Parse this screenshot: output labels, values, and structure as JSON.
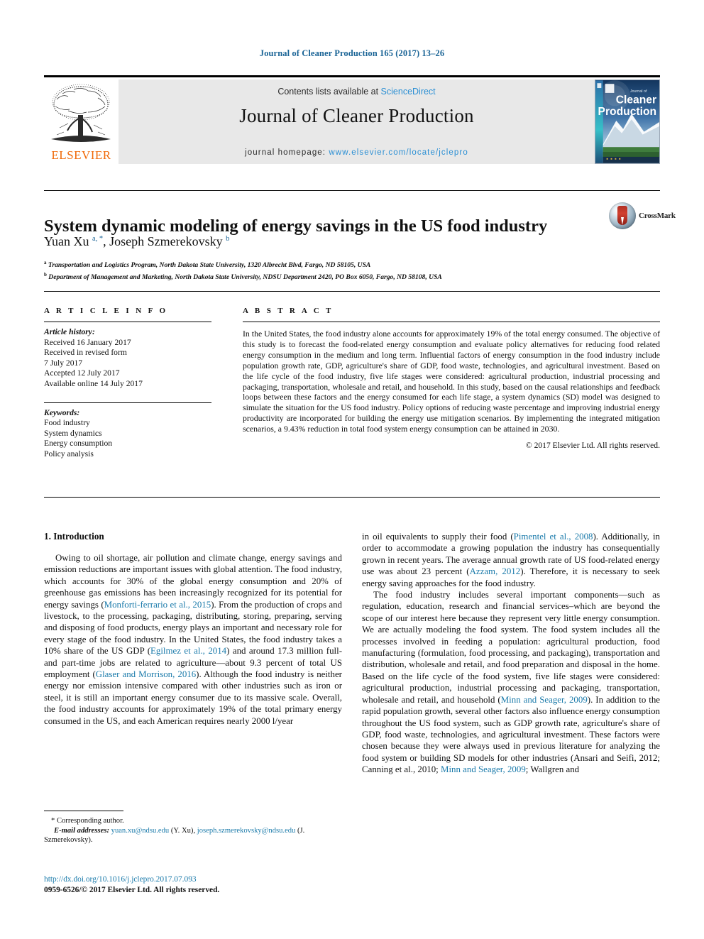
{
  "running_head": "Journal of Cleaner Production 165 (2017) 13–26",
  "masthead": {
    "publisher": "ELSEVIER",
    "contents_prefix": "Contents lists available at ",
    "contents_link": "ScienceDirect",
    "journal_title": "Journal of Cleaner Production",
    "homepage_prefix": "journal homepage: ",
    "homepage_url": "www.elsevier.com/locate/jclepro",
    "cover_title_small": "Journal of",
    "cover_title_line1": "Cleaner",
    "cover_title_line2": "Production"
  },
  "crossmark": {
    "label": "CrossMark"
  },
  "title": "System dynamic modeling of energy savings in the US food industry",
  "authors_html": "Yuan Xu <sup>a, *</sup>, Joseph Szmerekovsky <sup>b</sup>",
  "affiliations": [
    {
      "marker": "a",
      "text": "Transportation and Logistics Program, North Dakota State University, 1320 Albrecht Blvd, Fargo, ND 58105, USA"
    },
    {
      "marker": "b",
      "text": "Department of Management and Marketing, North Dakota State University, NDSU Department 2420, PO Box 6050, Fargo, ND 58108, USA"
    }
  ],
  "article_info": {
    "heading": "A R T I C L E  I N F O",
    "history_label": "Article history:",
    "history_lines": [
      "Received 16 January 2017",
      "Received in revised form",
      "7 July 2017",
      "Accepted 12 July 2017",
      "Available online 14 July 2017"
    ],
    "keywords_label": "Keywords:",
    "keywords": [
      "Food industry",
      "System dynamics",
      "Energy consumption",
      "Policy analysis"
    ]
  },
  "abstract": {
    "heading": "A B S T R A C T",
    "text": "In the United States, the food industry alone accounts for approximately 19% of the total energy consumed. The objective of this study is to forecast the food-related energy consumption and evaluate policy alternatives for reducing food related energy consumption in the medium and long term. Influential factors of energy consumption in the food industry include population growth rate, GDP, agriculture's share of GDP, food waste, technologies, and agricultural investment. Based on the life cycle of the food industry, five life stages were considered: agricultural production, industrial processing and packaging, transportation, wholesale and retail, and household. In this study, based on the causal relationships and feedback loops between these factors and the energy consumed for each life stage, a system dynamics (SD) model was designed to simulate the situation for the US food industry. Policy options of reducing waste percentage and improving industrial energy productivity are incorporated for building the energy use mitigation scenarios. By implementing the integrated mitigation scenarios, a 9.43% reduction in total food system energy consumption can be attained in 2030.",
    "copyright": "© 2017 Elsevier Ltd. All rights reserved."
  },
  "body": {
    "section_number_title": "1. Introduction",
    "left_paragraphs": [
      "Owing to oil shortage, air pollution and climate change, energy savings and emission reductions are important issues with global attention. The food industry, which accounts for 30% of the global energy consumption and 20% of greenhouse gas emissions has been increasingly recognized for its potential for energy savings (Monforti-ferrario et al., 2015). From the production of crops and livestock, to the processing, packaging, distributing, storing, preparing, serving and disposing of food products, energy plays an important and necessary role for every stage of the food industry. In the United States, the food industry takes a 10% share of the US GDP (Egilmez et al., 2014) and around 17.3 million full- and part-time jobs are related to agriculture—about 9.3 percent of total US employment (Glaser and Morrison, 2016). Although the food industry is neither energy nor emission intensive compared with other industries such as iron or steel, it is still an important energy consumer due to its massive scale. Overall, the food industry accounts for approximately 19% of the total primary energy consumed in the US, and each American requires nearly 2000 l/year"
    ],
    "left_citations": [
      "Monforti-ferrario et al., 2015",
      "Egilmez et al., 2014",
      "Glaser and Morrison, 2016"
    ],
    "right_paragraphs": [
      "in oil equivalents to supply their food (Pimentel et al., 2008). Additionally, in order to accommodate a growing population the industry has consequentially grown in recent years. The average annual growth rate of US food-related energy use was about 23 percent (Azzam, 2012). Therefore, it is necessary to seek energy saving approaches for the food industry.",
      "The food industry includes several important components—such as regulation, education, research and financial services–which are beyond the scope of our interest here because they represent very little energy consumption. We are actually modeling the food system. The food system includes all the processes involved in feeding a population: agricultural production, food manufacturing (formulation, food processing, and packaging), transportation and distribution, wholesale and retail, and food preparation and disposal in the home. Based on the life cycle of the food system, five life stages were considered: agricultural production, industrial processing and packaging, transportation, wholesale and retail, and household (Minn and Seager, 2009). In addition to the rapid population growth, several other factors also influence energy consumption throughout the US food system, such as GDP growth rate, agriculture's share of GDP, food waste, technologies, and agricultural investment. These factors were chosen because they were always used in previous literature for analyzing the food system or building SD models for other industries (Ansari and Seifi, 2012; Canning et al., 2010; Minn and Seager, 2009; Wallgren and"
    ],
    "right_citations": [
      "Pimentel et al., 2008",
      "Azzam, 2012",
      "Minn and Seager, 2009",
      "Ansari and Seifi, 2012; Canning et al., 2010; Minn and Seager, 2009; Wallgren and"
    ]
  },
  "footnote": {
    "corresponding": "* Corresponding author.",
    "email_label": "E-mail addresses:",
    "email1": "yuan.xu@ndsu.edu",
    "email1_name": "(Y. Xu),",
    "email2": "joseph.szmerekovsky@ndsu.edu",
    "email2_name": "(J. Szmerekovsky)."
  },
  "doi": {
    "url": "http://dx.doi.org/10.1016/j.jclepro.2017.07.093",
    "issn_line": "0959-6526/© 2017 Elsevier Ltd. All rights reserved."
  },
  "colors": {
    "link": "#1a7aaa",
    "running_head": "#1a6496",
    "elsevier_orange": "#f06a0a",
    "masthead_gray": "#e8e8e8"
  }
}
